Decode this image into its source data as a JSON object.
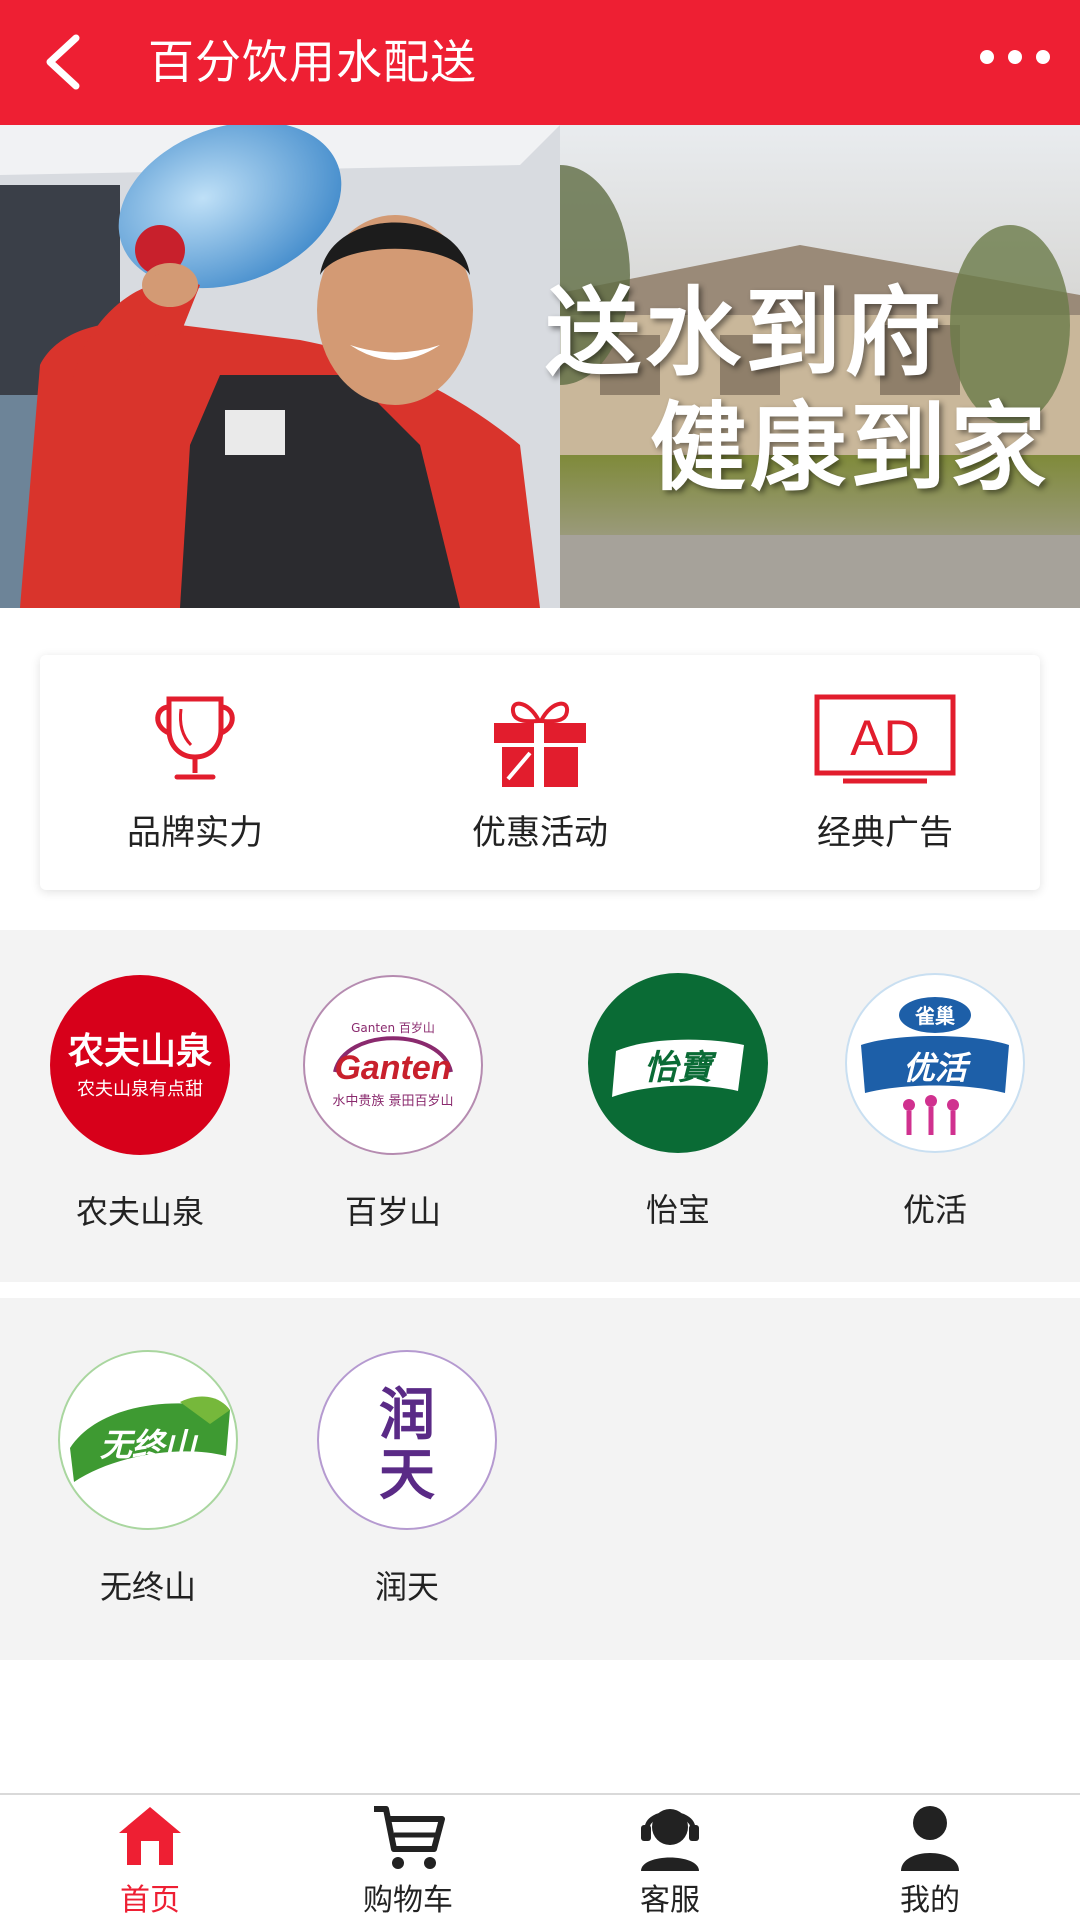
{
  "header": {
    "title": "百分饮用水配送",
    "back_icon": "chevron-left-icon",
    "more_icon": "ellipsis-icon",
    "background": "#ee1f33"
  },
  "banner": {
    "slogan_line1": "送水到府",
    "slogan_line2": "健康到家"
  },
  "features": [
    {
      "label": "品牌实力",
      "icon": "trophy-icon"
    },
    {
      "label": "优惠活动",
      "icon": "gift-icon"
    },
    {
      "label": "经典广告",
      "icon": "ad-tv-icon"
    }
  ],
  "brands_row1": [
    {
      "name": "农夫山泉",
      "logo_title": "农夫山泉",
      "logo_sub": "农夫山泉有点甜",
      "color": "#d7001a"
    },
    {
      "name": "百岁山",
      "logo_title": "Ganten",
      "logo_top": "Ganten 百岁山",
      "logo_sub": "水中贵族 景田百岁山",
      "color": "#8a2a6e"
    },
    {
      "name": "怡宝",
      "logo_title": "怡寶",
      "color": "#0a6b35"
    },
    {
      "name": "优活",
      "logo_top": "雀巢",
      "logo_title": "优活",
      "color": "#1d5fa8"
    }
  ],
  "brands_row2": [
    {
      "name": "无终山",
      "logo_title": "无终山",
      "color": "#3e9a32"
    },
    {
      "name": "润天",
      "logo_title": "润",
      "logo_title2": "天",
      "color": "#5a2a86"
    }
  ],
  "tabbar": {
    "tabs": [
      {
        "label": "首页",
        "icon": "home-icon",
        "active": true
      },
      {
        "label": "购物车",
        "icon": "cart-icon",
        "active": false
      },
      {
        "label": "客服",
        "icon": "customer-service-icon",
        "active": false
      },
      {
        "label": "我的",
        "icon": "user-icon",
        "active": false
      }
    ],
    "active_color": "#ee1f33"
  }
}
